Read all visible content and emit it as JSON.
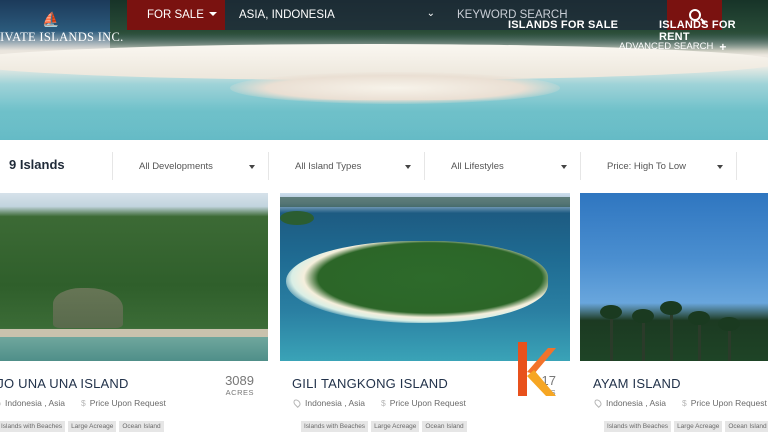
{
  "header": {
    "logo": {
      "name": "PRIVATE ISLANDS INC.",
      "visible_name": "IVATE ISLANDS INC."
    },
    "search": {
      "mode_label": "FOR SALE",
      "location_value": "ASIA, INDONESIA",
      "keyword_placeholder": "KEYWORD SEARCH"
    },
    "nav": {
      "sale_label": "ISLANDS FOR SALE",
      "rent_label": "ISLANDS FOR RENT",
      "advanced_label": "ADVANCED SEARCH",
      "advanced_plus": "+"
    },
    "colors": {
      "accent": "#7a1210"
    }
  },
  "filters": {
    "count_label": "9 Islands",
    "developments": "All Developments",
    "island_types": "All Island Types",
    "lifestyles": "All Lifestyles",
    "sort": "Price: High To Low"
  },
  "listings": [
    {
      "title": "OJO UNA UNA ISLAND",
      "acres_value": "3089",
      "acres_label": "ACRES",
      "location": "Indonesia , Asia",
      "price": "Price Upon Request",
      "tags": [
        "Islands with Beaches",
        "Large Acreage",
        "Ocean Island"
      ]
    },
    {
      "title": "GILI TANGKONG ISLAND",
      "acres_value": "17",
      "acres_label": "ES",
      "location": "Indonesia , Asia",
      "price": "Price Upon Request",
      "tags": [
        "Islands with Beaches",
        "Large Acreage",
        "Ocean Island"
      ]
    },
    {
      "title": "AYAM ISLAND",
      "location": "Indonesia , Asia",
      "price": "Price Upon Request",
      "tags": [
        "Islands with Beaches",
        "Large Acreage",
        "Ocean Island"
      ]
    }
  ],
  "watermark": {
    "colors": [
      "#e8511c",
      "#f6a623"
    ]
  }
}
